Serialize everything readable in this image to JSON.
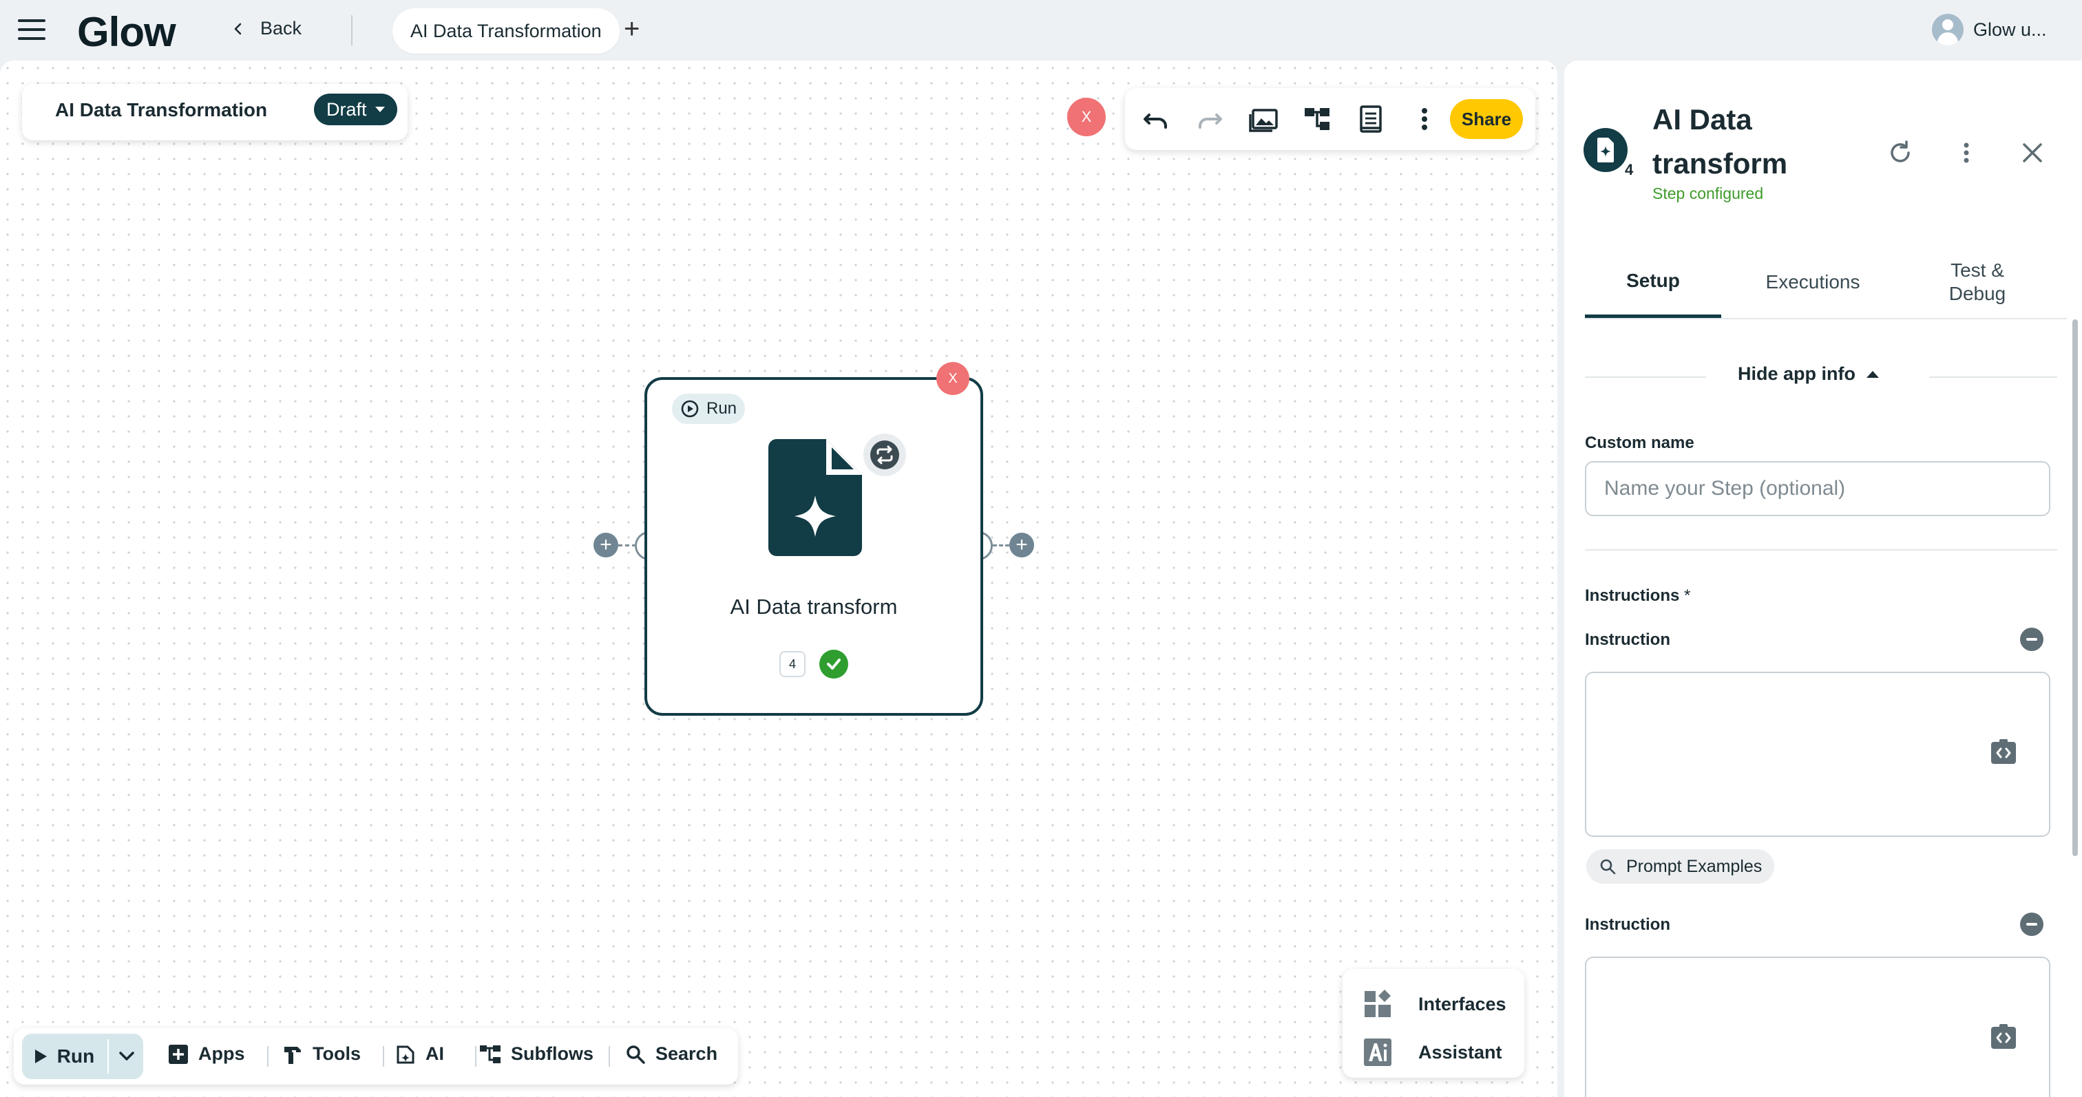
{
  "app": {
    "logo": "Glow",
    "back_label": "Back",
    "open_tab": "AI Data Transformation",
    "user_name": "Glow u..."
  },
  "canvas": {
    "workflow_title": "AI Data Transformation",
    "status_label": "Draft",
    "close_label": "X",
    "toolbar": {
      "icons": [
        "undo-icon",
        "redo-icon",
        "gallery-icon",
        "tree-icon",
        "notes-icon",
        "more-vertical-icon"
      ],
      "share_label": "Share"
    },
    "node": {
      "run_label": "Run",
      "close_label": "X",
      "title": "AI Data transform",
      "count": "4",
      "configured": true
    },
    "bottom_bar": {
      "run_label": "Run",
      "items": [
        {
          "label": "Apps",
          "icon": "plus-square-icon"
        },
        {
          "label": "Tools",
          "icon": "hammer-icon"
        },
        {
          "label": "AI",
          "icon": "ai-doc-icon"
        },
        {
          "label": "Subflows",
          "icon": "subflow-icon"
        },
        {
          "label": "Search",
          "icon": "search-icon"
        }
      ]
    },
    "side_menu": [
      {
        "label": "Interfaces",
        "icon": "interfaces-icon"
      },
      {
        "label": "Assistant",
        "icon": "ai-assistant-icon"
      }
    ]
  },
  "panel": {
    "step_number": "4",
    "title": "AI Data transform",
    "status": "Step configured",
    "tabs": [
      "Setup",
      "Executions",
      "Test & Debug"
    ],
    "active_tab": "Setup",
    "hide_info_label": "Hide app info",
    "custom_name_label": "Custom name",
    "custom_name_placeholder": "Name your Step (optional)",
    "custom_name_value": "",
    "instructions_label": "Instructions",
    "required_mark": "*",
    "instruction_label": "Instruction",
    "prompt_examples_label": "Prompt Examples",
    "colors": {
      "accent": "#123c46",
      "share": "#ffc800",
      "success": "#3e9b2a",
      "danger": "#f07274"
    }
  }
}
